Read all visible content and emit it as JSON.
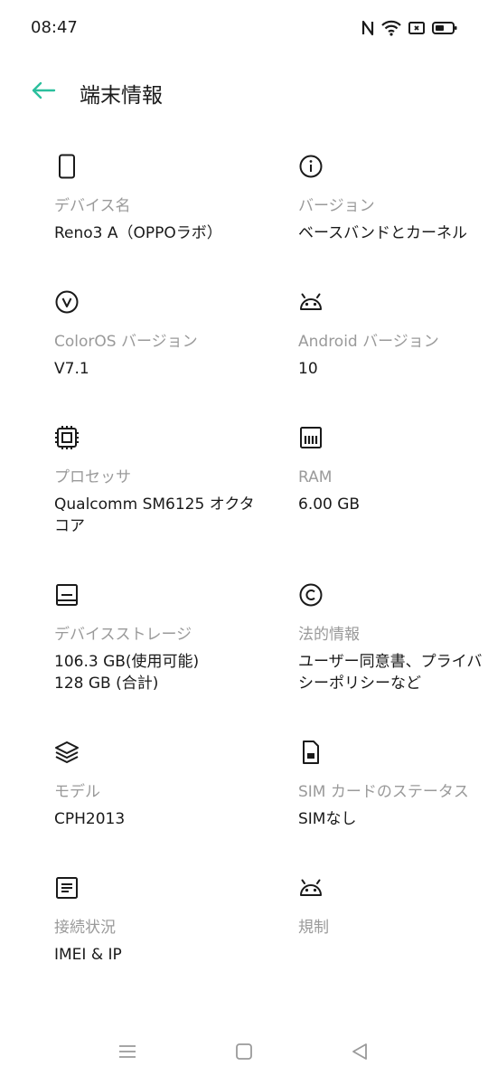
{
  "status": {
    "time": "08:47",
    "icons": [
      "nfc-icon",
      "wifi-icon",
      "screen-record-icon",
      "battery-icon"
    ]
  },
  "header": {
    "title": "端末情報",
    "back_icon": "arrow-left-icon",
    "accent_color": "#2bbf9d"
  },
  "items": [
    {
      "icon": "phone-icon",
      "label": "デバイス名",
      "value": "Reno3 A（OPPOラボ）"
    },
    {
      "icon": "info-icon",
      "label": "バージョン",
      "value": "ベースバンドとカーネル"
    },
    {
      "icon": "coloros-v-icon",
      "label": "ColorOS バージョン",
      "value": "V7.1"
    },
    {
      "icon": "android-icon",
      "label": "Android バージョン",
      "value": "10"
    },
    {
      "icon": "cpu-icon",
      "label": "プロセッサ",
      "value": "Qualcomm SM6125 オクタコア"
    },
    {
      "icon": "ram-icon",
      "label": "RAM",
      "value": "6.00 GB"
    },
    {
      "icon": "storage-icon",
      "label": "デバイスストレージ",
      "value_lines": [
        "106.3 GB(使用可能)",
        "128 GB (合計)"
      ]
    },
    {
      "icon": "copyright-icon",
      "label": "法的情報",
      "value": "ユーザー同意書、プライバシーポリシーなど"
    },
    {
      "icon": "layers-icon",
      "label": "モデル",
      "value": "CPH2013"
    },
    {
      "icon": "sim-card-icon",
      "label": "SIM カードのステータス",
      "value": "SIMなし"
    },
    {
      "icon": "document-icon",
      "label": "接続状況",
      "value": "IMEI & IP"
    },
    {
      "icon": "android-icon",
      "label": "規制",
      "value": ""
    }
  ],
  "navbar": {
    "buttons": [
      "menu-icon",
      "home-icon",
      "back-triangle-icon"
    ]
  }
}
